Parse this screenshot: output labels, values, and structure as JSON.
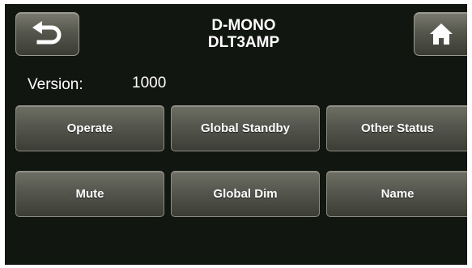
{
  "header": {
    "title_line1": "D-MONO",
    "title_line2": "DLT3AMP",
    "back_icon": "back-arrow-icon",
    "home_icon": "home-icon"
  },
  "info": {
    "version_label": "Version:",
    "version_value": "1000"
  },
  "buttons": {
    "row1": [
      "Operate",
      "Global Standby",
      "Other Status"
    ],
    "row2": [
      "Mute",
      "Global Dim",
      "Name"
    ]
  },
  "colors": {
    "background": "#121611",
    "button_top": "#6d6e64",
    "button_bottom": "#3c3d35",
    "text": "#ffffff"
  }
}
